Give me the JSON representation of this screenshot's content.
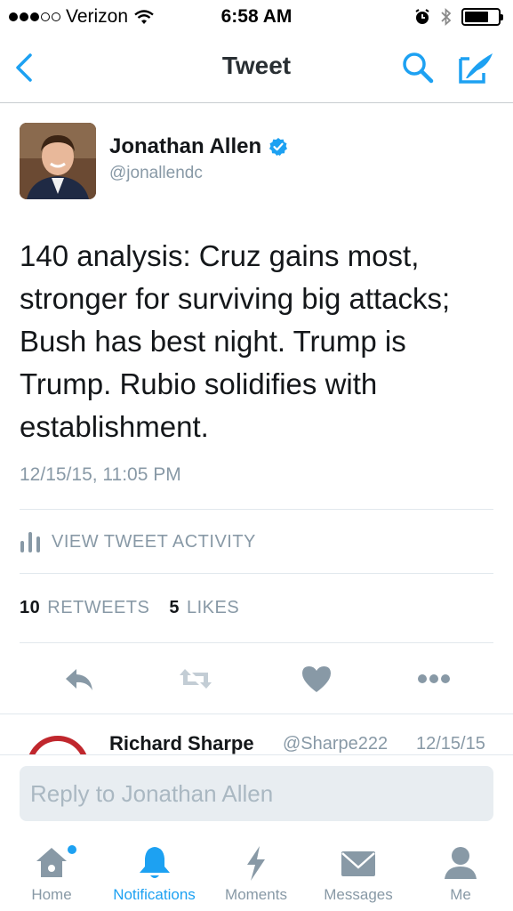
{
  "status_bar": {
    "carrier": "Verizon",
    "time": "6:58 AM",
    "signal_bars_filled": 3,
    "signal_bars_total": 5,
    "battery_level": 0.65
  },
  "nav": {
    "title": "Tweet",
    "back_icon": "back-chevron-icon",
    "search_icon": "search-icon",
    "compose_icon": "compose-icon"
  },
  "tweet": {
    "author_name": "Jonathan Allen",
    "author_handle": "@jonallendc",
    "verified": true,
    "text": "140 analysis: Cruz gains most, stronger for surviving big attacks; Bush has best night. Trump is Trump. Rubio solidifies with establishment.",
    "timestamp": "12/15/15, 11:05 PM",
    "activity_label": "VIEW TWEET ACTIVITY",
    "retweets_count": "10",
    "retweets_label": "RETWEETS",
    "likes_count": "5",
    "likes_label": "LIKES"
  },
  "reply_preview": {
    "name": "Richard Sharpe",
    "handle": "@Sharpe222",
    "date": "12/15/15"
  },
  "composer": {
    "placeholder": "Reply to Jonathan Allen"
  },
  "tabs": [
    {
      "label": "Home",
      "icon": "home-icon",
      "active": false,
      "has_dot": true
    },
    {
      "label": "Notifications",
      "icon": "bell-icon",
      "active": true,
      "has_dot": false
    },
    {
      "label": "Moments",
      "icon": "lightning-icon",
      "active": false,
      "has_dot": false
    },
    {
      "label": "Messages",
      "icon": "envelope-icon",
      "active": false,
      "has_dot": false
    },
    {
      "label": "Me",
      "icon": "person-icon",
      "active": false,
      "has_dot": false
    }
  ],
  "colors": {
    "accent": "#1da1f2",
    "text_primary": "#14171a",
    "text_secondary": "#8899a6",
    "divider": "#e1e8ed",
    "icon_gray": "#8899a6"
  }
}
